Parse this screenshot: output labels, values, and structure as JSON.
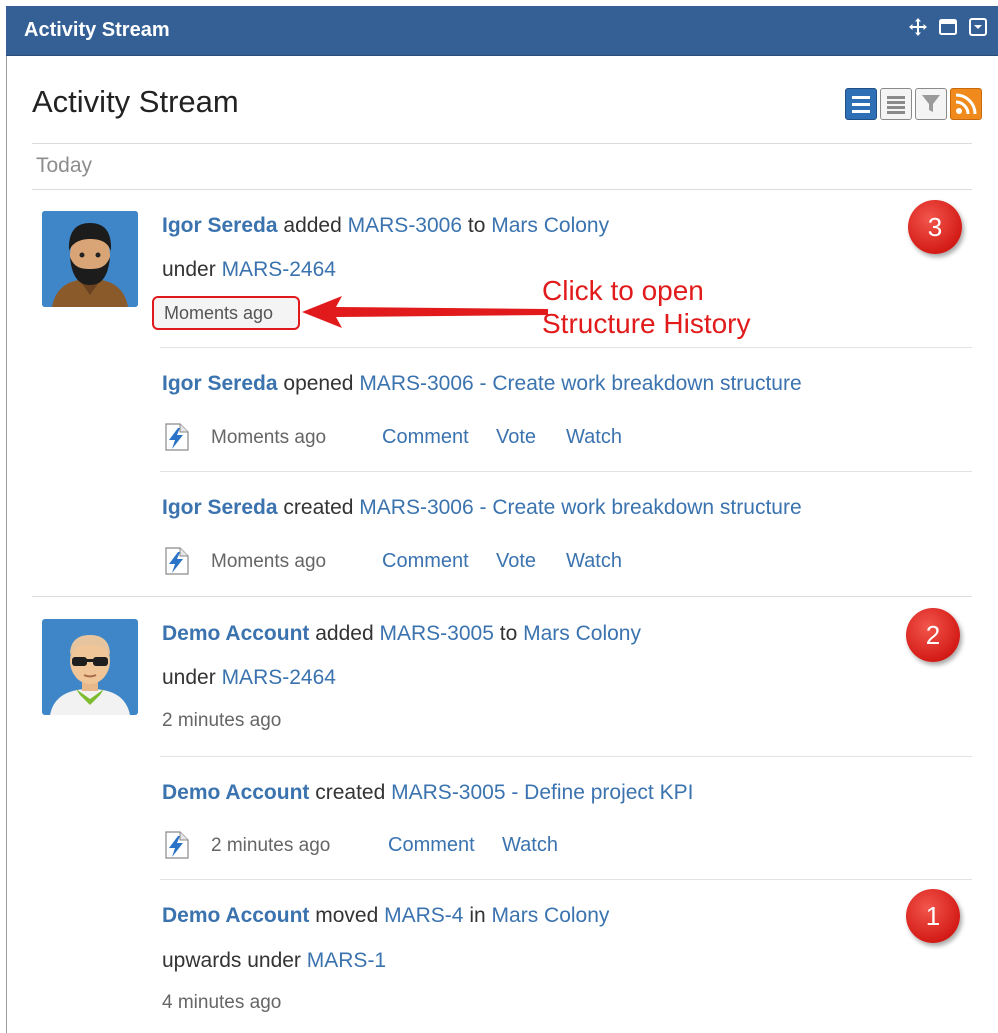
{
  "gadget": {
    "title": "Activity Stream",
    "heading": "Activity Stream",
    "group_label": "Today",
    "icons": [
      "move-icon",
      "maximize-icon",
      "menu-icon"
    ],
    "view_icons": [
      "full-view-icon",
      "list-view-icon",
      "filter-icon",
      "rss-icon"
    ]
  },
  "entries": [
    {
      "user": "Igor Sereda",
      "verb1": "added",
      "issue": "MARS-3006",
      "prep": "to",
      "project": "Mars Colony",
      "line2_text": "under",
      "line2_link": "MARS-2464",
      "time": "Moments ago",
      "badge": "3"
    },
    {
      "user": "Igor Sereda",
      "verb": "opened",
      "issue": "MARS-3006 - Create work breakdown structure",
      "time": "Moments ago",
      "actions": [
        "Comment",
        "Vote",
        "Watch"
      ]
    },
    {
      "user": "Igor Sereda",
      "verb": "created",
      "issue": "MARS-3006 - Create work breakdown structure",
      "time": "Moments ago",
      "actions": [
        "Comment",
        "Vote",
        "Watch"
      ]
    },
    {
      "user": "Demo Account",
      "verb1": "added",
      "issue": "MARS-3005",
      "prep": "to",
      "project": "Mars Colony",
      "line2_text": "under",
      "line2_link": "MARS-2464",
      "time": "2 minutes ago",
      "badge": "2"
    },
    {
      "user": "Demo Account",
      "verb": "created",
      "issue": "MARS-3005 - Define project KPI",
      "time": "2 minutes ago",
      "actions": [
        "Comment",
        "Watch"
      ]
    },
    {
      "user": "Demo Account",
      "verb1": "moved",
      "issue": "MARS-4",
      "prep": "in",
      "project": "Mars Colony",
      "line2_text": "upwards under",
      "line2_link": "MARS-1",
      "time": "4 minutes ago",
      "badge": "1"
    }
  ],
  "callout": {
    "line1": "Click to open",
    "line2": "Structure History"
  },
  "colors": {
    "titlebar": "#346095",
    "link": "#3b73af",
    "callout": "#e11b1b",
    "badge": "#d41c17"
  }
}
